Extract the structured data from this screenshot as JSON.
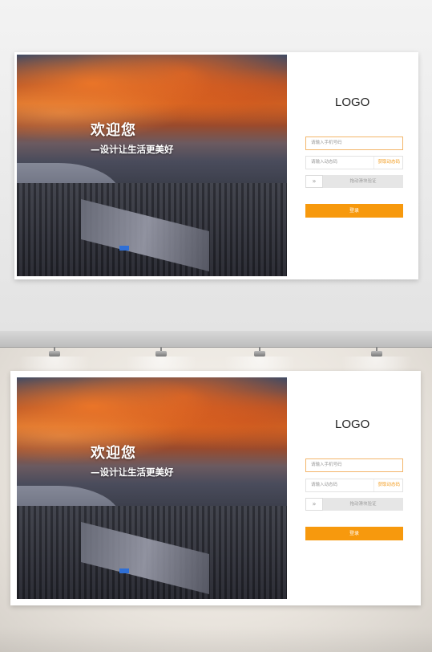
{
  "login_card": {
    "welcome": "欢迎您",
    "slogan": "—设计让生活更美好",
    "logo": "LOGO",
    "phone_placeholder": "请输入手机号码",
    "code_placeholder": "请输入动态码",
    "get_code": "获取动态码",
    "slider_text": "拖动滑块验证",
    "login_button": "登录"
  },
  "colors": {
    "accent": "#f7990d",
    "accent_text": "#f29c1f",
    "active_border": "#f3b66b"
  },
  "icons": {
    "slider_handle": "double-chevron-right-icon"
  }
}
